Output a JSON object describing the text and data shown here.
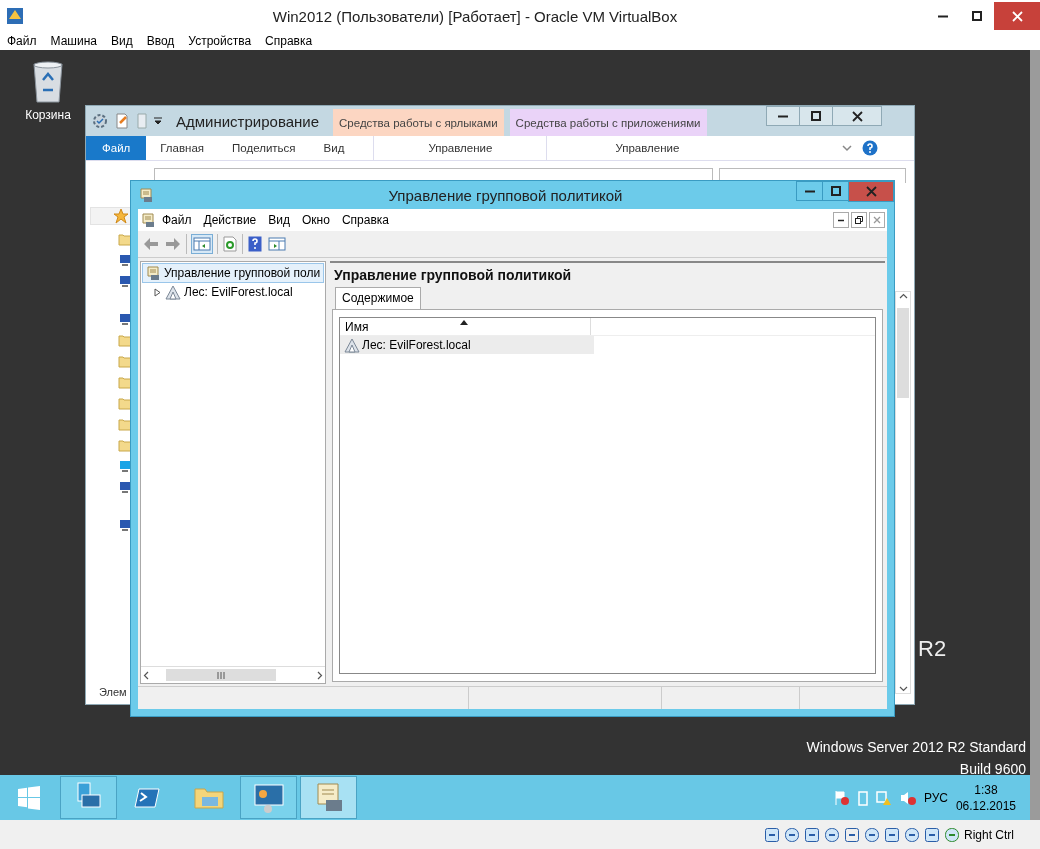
{
  "vbox": {
    "title": "Win2012 (Пользователи) [Работает] - Oracle VM VirtualBox",
    "menu": [
      "Файл",
      "Машина",
      "Вид",
      "Ввод",
      "Устройства",
      "Справка"
    ],
    "host_key": "Right Ctrl"
  },
  "desktop": {
    "icons": [
      {
        "label": "Корзина"
      }
    ],
    "brand_fragment": "R2",
    "edition": "Windows Server 2012 R2 Standard",
    "build": "Build 9600"
  },
  "explorer": {
    "title": "Администрирование",
    "context_tabs": [
      {
        "label": "Средства работы с ярлыками",
        "group": "Управление",
        "color": "#fcd6c2"
      },
      {
        "label": "Средства работы с приложениями",
        "group": "Управление",
        "color": "#ead3f8"
      }
    ],
    "ribbon_tabs": [
      {
        "label": "Файл",
        "selected": true
      },
      {
        "label": "Главная",
        "selected": false
      },
      {
        "label": "Поделиться",
        "selected": false
      },
      {
        "label": "Вид",
        "selected": false
      }
    ],
    "status": "Элем"
  },
  "gpmc": {
    "title": "Управление групповой политикой",
    "menu": [
      "Файл",
      "Действие",
      "Вид",
      "Окно",
      "Справка"
    ],
    "tree": [
      {
        "label": "Управление групповой поли",
        "selected": true,
        "children": [
          {
            "label": "Лес: EvilForest.local",
            "selected": false,
            "expanded": false
          }
        ]
      }
    ],
    "heading": "Управление групповой политикой",
    "tabs": [
      {
        "label": "Содержимое",
        "selected": true
      }
    ],
    "columns": [
      "Имя"
    ],
    "rows": [
      {
        "name": "Лес: EvilForest.local",
        "selected": true
      }
    ]
  },
  "taskbar": {
    "apps": [
      {
        "kind": "server",
        "pinned_open": true,
        "focused": false
      },
      {
        "kind": "powershell",
        "pinned_open": false,
        "focused": false
      },
      {
        "kind": "explorer",
        "pinned_open": false,
        "focused": false
      },
      {
        "kind": "control",
        "pinned_open": true,
        "focused": false
      },
      {
        "kind": "gpmc",
        "pinned_open": true,
        "focused": true
      }
    ],
    "lang": "РУС",
    "time": "1:38",
    "date": "06.12.2015"
  }
}
